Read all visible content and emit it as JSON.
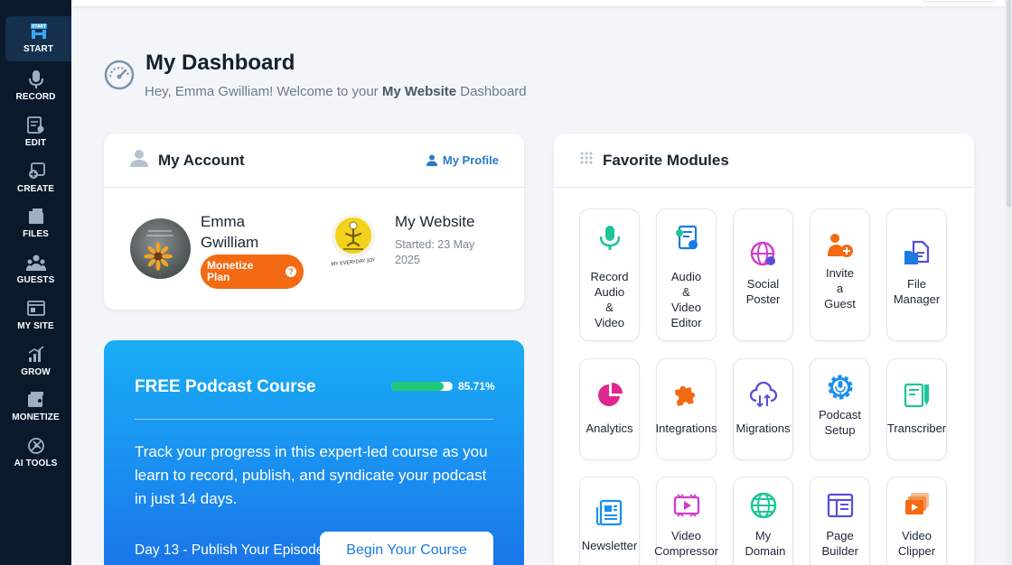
{
  "sidebar": {
    "items": [
      {
        "label": "START",
        "icon": "start-icon",
        "active": true
      },
      {
        "label": "RECORD",
        "icon": "microphone-icon"
      },
      {
        "label": "EDIT",
        "icon": "edit-icon"
      },
      {
        "label": "CREATE",
        "icon": "create-icon"
      },
      {
        "label": "FILES",
        "icon": "files-icon"
      },
      {
        "label": "GUESTS",
        "icon": "guests-icon"
      },
      {
        "label": "MY SITE",
        "icon": "my-site-icon"
      },
      {
        "label": "GROW",
        "icon": "grow-icon"
      },
      {
        "label": "MONETIZE",
        "icon": "monetize-icon"
      },
      {
        "label": "AI TOOLS",
        "icon": "ai-tools-icon"
      }
    ]
  },
  "header": {
    "title": "My Dashboard",
    "greeting_prefix": "Hey, Emma Gwilliam! Welcome to your ",
    "site_name_bold": "My Website",
    "greeting_suffix": " Dashboard"
  },
  "account": {
    "title": "My Account",
    "profile_link": "My Profile",
    "user_name": "Emma Gwilliam",
    "plan": "Monetize Plan",
    "plan_help": "?",
    "site_name": "My Website",
    "site_started": "Started: 23 May 2025",
    "site_logo_text": "MY EVERYDAY JOY"
  },
  "course": {
    "title": "FREE Podcast Course",
    "progress_percent": 85.71,
    "progress_label": "85.71%",
    "description": "Track your progress in this expert-led course as you learn to record, publish, and syndicate your podcast in just 14 days.",
    "current_lesson": "Day 13 - Publish Your Episode",
    "button": "Begin Your Course"
  },
  "favorites": {
    "title": "Favorite Modules",
    "modules": [
      {
        "label": "Record Audio & Video",
        "icon": "microphone-icon",
        "color": "#1fc49a"
      },
      {
        "label": "Audio & Video Editor",
        "icon": "audio-video-editor-icon",
        "color": "#1a7ae2"
      },
      {
        "label": "Social Poster",
        "icon": "social-poster-icon",
        "color": "#d23bc9"
      },
      {
        "label": "Invite a Guest",
        "icon": "invite-guest-icon",
        "color": "#f36a12"
      },
      {
        "label": "File Manager",
        "icon": "file-manager-icon",
        "color": "#5a4fd6"
      },
      {
        "label": "Analytics",
        "icon": "analytics-pie-icon",
        "color": "#e0268f"
      },
      {
        "label": "Integrations",
        "icon": "integrations-puzzle-icon",
        "color": "#f36a12"
      },
      {
        "label": "Migrations",
        "icon": "migrations-cloud-icon",
        "color": "#5a4fd6"
      },
      {
        "label": "Podcast Setup",
        "icon": "podcast-setup-gear-icon",
        "color": "#1a8ff0"
      },
      {
        "label": "Transcriber",
        "icon": "transcriber-icon",
        "color": "#1fc49a"
      },
      {
        "label": "Newsletter",
        "icon": "newsletter-icon",
        "color": "#1a8ff0"
      },
      {
        "label": "Video Compressor",
        "icon": "video-compressor-icon",
        "color": "#d23bc9"
      },
      {
        "label": "My Domain",
        "icon": "globe-icon",
        "color": "#1fc49a"
      },
      {
        "label": "Page Builder",
        "icon": "page-builder-icon",
        "color": "#5a4fd6"
      },
      {
        "label": "Video Clipper",
        "icon": "video-clipper-icon",
        "color": "#f36a12"
      }
    ]
  }
}
